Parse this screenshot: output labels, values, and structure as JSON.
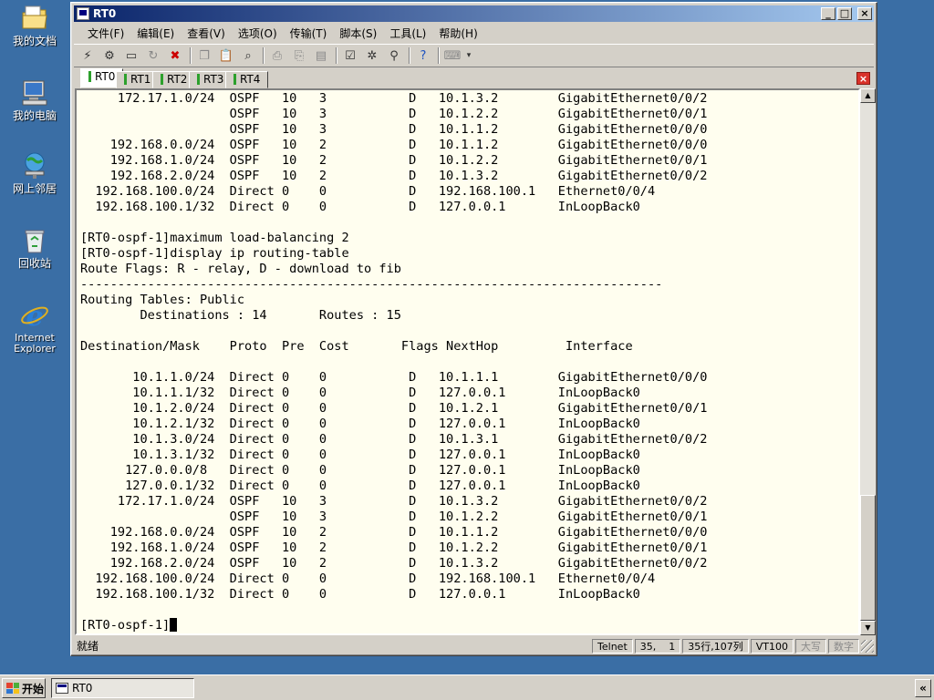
{
  "desktop": {
    "icons": [
      {
        "label": "我的文档",
        "icon": "folder-documents-icon"
      },
      {
        "label": "我的电脑",
        "icon": "computer-icon"
      },
      {
        "label": "网上邻居",
        "icon": "network-icon"
      },
      {
        "label": "回收站",
        "icon": "recycle-bin-icon"
      },
      {
        "label": "Internet Explorer",
        "icon": "internet-explorer-icon"
      }
    ]
  },
  "window": {
    "title": "RT0",
    "controls": {
      "minimize": "_",
      "maximize": "□",
      "close": "×"
    }
  },
  "menubar": {
    "items": [
      "文件(F)",
      "编辑(E)",
      "查看(V)",
      "选项(O)",
      "传输(T)",
      "脚本(S)",
      "工具(L)",
      "帮助(H)"
    ]
  },
  "tabs": [
    {
      "label": "RT0",
      "active": true
    },
    {
      "label": "RT1",
      "active": false
    },
    {
      "label": "RT2",
      "active": false
    },
    {
      "label": "RT3",
      "active": false
    },
    {
      "label": "RT4",
      "active": false
    }
  ],
  "tab_close": "×",
  "terminal": {
    "lines": [
      "     172.17.1.0/24  OSPF   10   3           D   10.1.3.2        GigabitEthernet0/0/2",
      "                    OSPF   10   3           D   10.1.2.2        GigabitEthernet0/0/1",
      "                    OSPF   10   3           D   10.1.1.2        GigabitEthernet0/0/0",
      "    192.168.0.0/24  OSPF   10   2           D   10.1.1.2        GigabitEthernet0/0/0",
      "    192.168.1.0/24  OSPF   10   2           D   10.1.2.2        GigabitEthernet0/0/1",
      "    192.168.2.0/24  OSPF   10   2           D   10.1.3.2        GigabitEthernet0/0/2",
      "  192.168.100.0/24  Direct 0    0           D   192.168.100.1   Ethernet0/0/4",
      "  192.168.100.1/32  Direct 0    0           D   127.0.0.1       InLoopBack0",
      "",
      "[RT0-ospf-1]maximum load-balancing 2",
      "[RT0-ospf-1]display ip routing-table",
      "Route Flags: R - relay, D - download to fib",
      "------------------------------------------------------------------------------",
      "Routing Tables: Public",
      "        Destinations : 14       Routes : 15",
      "",
      "Destination/Mask    Proto  Pre  Cost       Flags NextHop         Interface",
      "",
      "       10.1.1.0/24  Direct 0    0           D   10.1.1.1        GigabitEthernet0/0/0",
      "       10.1.1.1/32  Direct 0    0           D   127.0.0.1       InLoopBack0",
      "       10.1.2.0/24  Direct 0    0           D   10.1.2.1        GigabitEthernet0/0/1",
      "       10.1.2.1/32  Direct 0    0           D   127.0.0.1       InLoopBack0",
      "       10.1.3.0/24  Direct 0    0           D   10.1.3.1        GigabitEthernet0/0/2",
      "       10.1.3.1/32  Direct 0    0           D   127.0.0.1       InLoopBack0",
      "      127.0.0.0/8   Direct 0    0           D   127.0.0.1       InLoopBack0",
      "      127.0.0.1/32  Direct 0    0           D   127.0.0.1       InLoopBack0",
      "     172.17.1.0/24  OSPF   10   3           D   10.1.3.2        GigabitEthernet0/0/2",
      "                    OSPF   10   3           D   10.1.2.2        GigabitEthernet0/0/1",
      "    192.168.0.0/24  OSPF   10   2           D   10.1.1.2        GigabitEthernet0/0/0",
      "    192.168.1.0/24  OSPF   10   2           D   10.1.2.2        GigabitEthernet0/0/1",
      "    192.168.2.0/24  OSPF   10   2           D   10.1.3.2        GigabitEthernet0/0/2",
      "  192.168.100.0/24  Direct 0    0           D   192.168.100.1   Ethernet0/0/4",
      "  192.168.100.1/32  Direct 0    0           D   127.0.0.1       InLoopBack0",
      ""
    ],
    "prompt": "[RT0-ospf-1]"
  },
  "statusbar": {
    "ready": "就绪",
    "protocol": "Telnet",
    "cursor_pos": "35,    1",
    "size": "35行,107列",
    "emulation": "VT100",
    "caps": "大写",
    "num": "数字"
  },
  "taskbar": {
    "start": "开始",
    "task_label": "RT0",
    "tray_toggle": "«"
  }
}
